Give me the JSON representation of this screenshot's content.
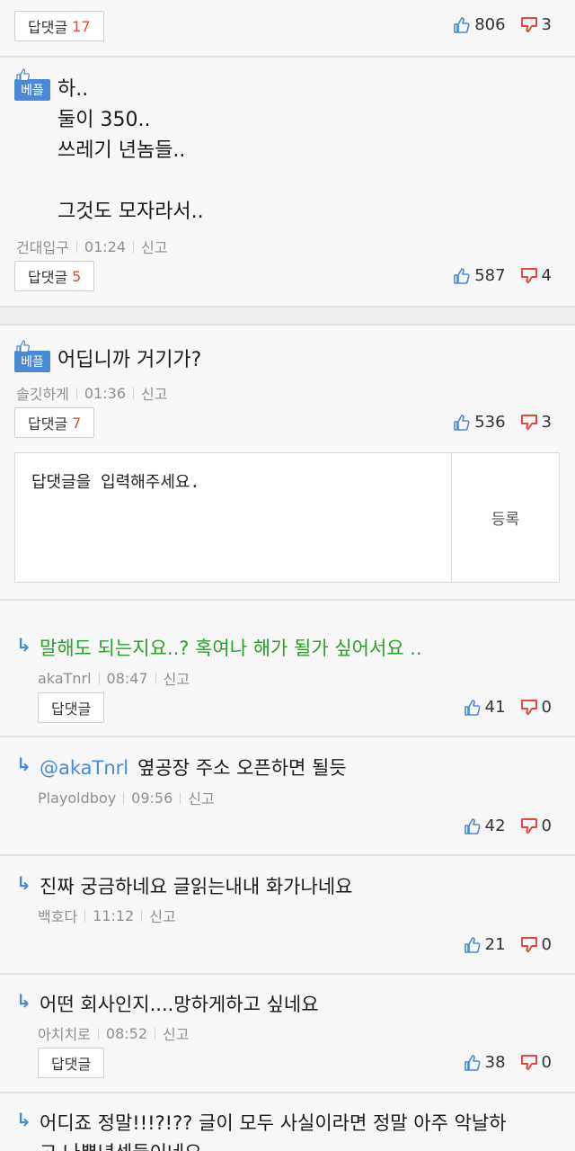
{
  "colors": {
    "accent": "#4a89d6",
    "count_red": "#e2483d",
    "reply_green": "#2aa02a",
    "meta_gray": "#8f8f8f"
  },
  "icons": {
    "upvote": "thumb-up-icon",
    "downvote": "thumb-down-icon",
    "best": "best-hand-icon",
    "reply_arrow": "reply-arrow-icon"
  },
  "comments": [
    {
      "reply_label": "답댓글",
      "reply_count": "17",
      "up": "806",
      "down": "3"
    },
    {
      "badge": "베플",
      "text": "하..\n둘이 350..\n쓰레기 년놈들..\n\n그것도 모자라서..",
      "author": "건대입구",
      "time": "01:24",
      "report": "신고",
      "reply_label": "답댓글",
      "reply_count": "5",
      "up": "587",
      "down": "4"
    },
    {
      "badge": "베플",
      "text": "어딥니까 거기가?",
      "author": "솔깃하게",
      "time": "01:36",
      "report": "신고",
      "reply_label": "답댓글",
      "reply_count": "7",
      "up": "536",
      "down": "3"
    }
  ],
  "reply_input": {
    "placeholder": "답댓글을 입력해주세요.",
    "submit": "등록"
  },
  "replies": [
    {
      "arrow": "↳",
      "text": "말해도 되는지요..? 혹여나 해가 될가 싶어서요 ..",
      "author": "akaTnrl",
      "time": "08:47",
      "report": "신고",
      "reply_label": "답댓글",
      "up": "41",
      "down": "0"
    },
    {
      "arrow": "↳",
      "mention": "@akaTnrl",
      "text": "옆공장 주소 오픈하면 될듯",
      "author": "Playoldboy",
      "time": "09:56",
      "report": "신고",
      "up": "42",
      "down": "0"
    },
    {
      "arrow": "↳",
      "text": "진짜 궁금하네요 글읽는내내 화가나네요",
      "author": "백호다",
      "time": "11:12",
      "report": "신고",
      "up": "21",
      "down": "0"
    },
    {
      "arrow": "↳",
      "text": "어떤 회사인지....망하게하고 싶네요",
      "author": "아치치로",
      "time": "08:52",
      "report": "신고",
      "reply_label": "답댓글",
      "up": "38",
      "down": "0"
    },
    {
      "arrow": "↳",
      "text_line1": "어디죠 정말!!!?!?? 글이 모두 사실이라면 정말 아주 악날하",
      "text_line2": "고 나쁜년섹들이네요"
    }
  ]
}
